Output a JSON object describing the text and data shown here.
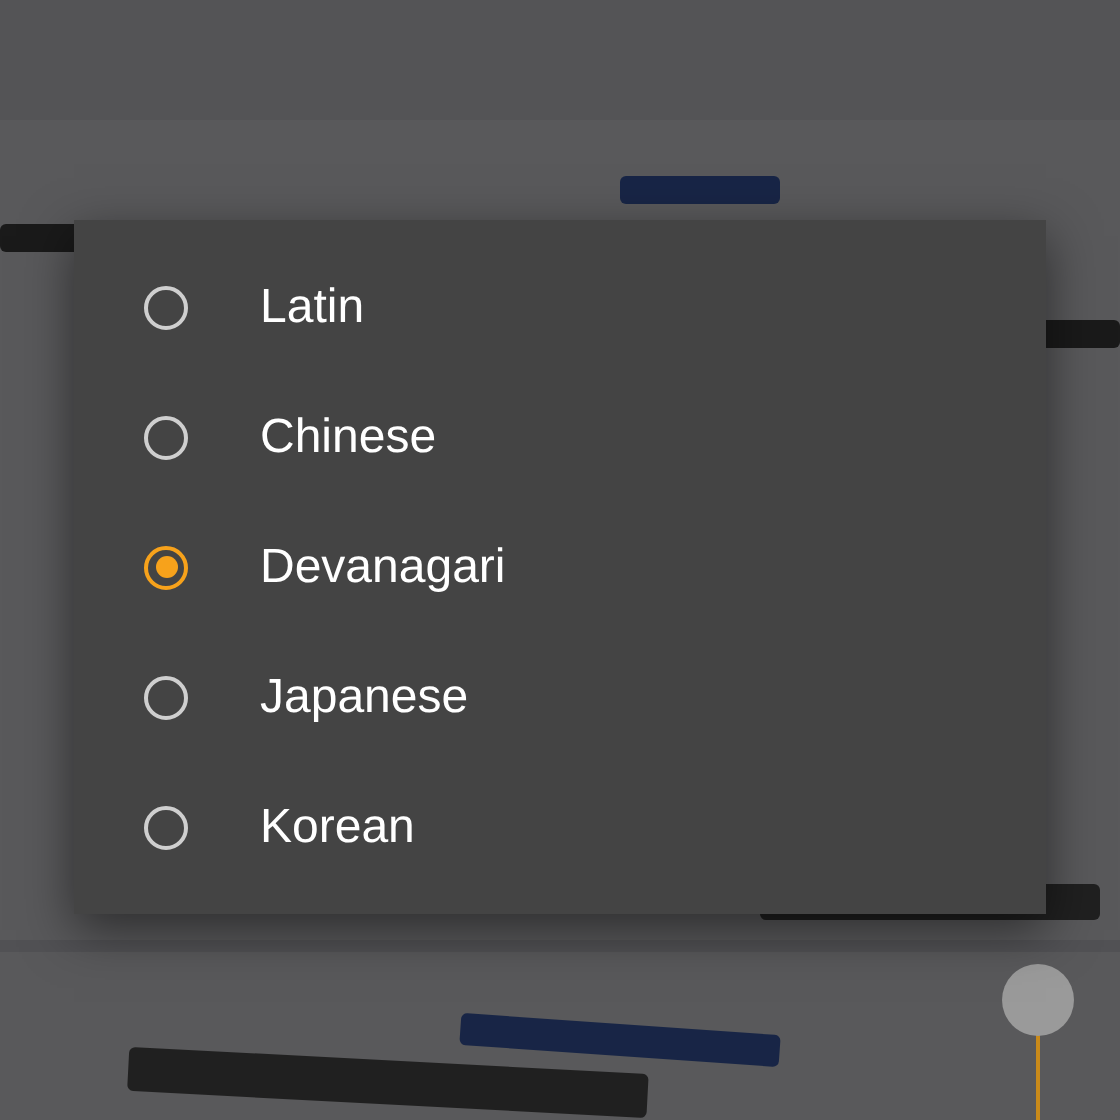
{
  "dialog": {
    "options": [
      {
        "label": "Latin",
        "selected": false
      },
      {
        "label": "Chinese",
        "selected": false
      },
      {
        "label": "Devanagari",
        "selected": true
      },
      {
        "label": "Japanese",
        "selected": false
      },
      {
        "label": "Korean",
        "selected": false
      }
    ]
  }
}
